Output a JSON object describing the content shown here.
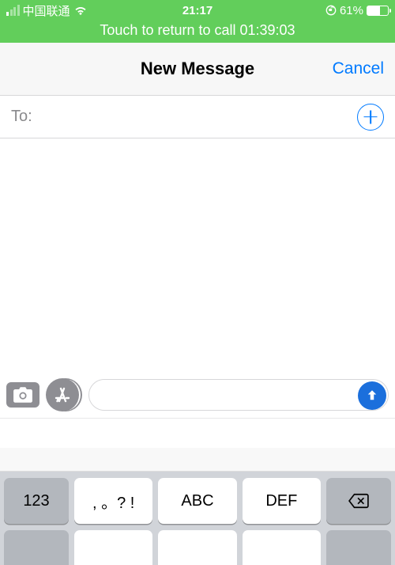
{
  "status": {
    "carrier": "中国联通",
    "time": "21:17",
    "battery_pct": "61%"
  },
  "call_banner": {
    "text": "Touch to return to call 01:39:03"
  },
  "nav": {
    "title": "New Message",
    "cancel": "Cancel"
  },
  "to_row": {
    "label": "To:"
  },
  "keyboard": {
    "row1": {
      "func": "123",
      "k1": ", 。? !",
      "k2": "ABC",
      "k3": "DEF"
    }
  }
}
